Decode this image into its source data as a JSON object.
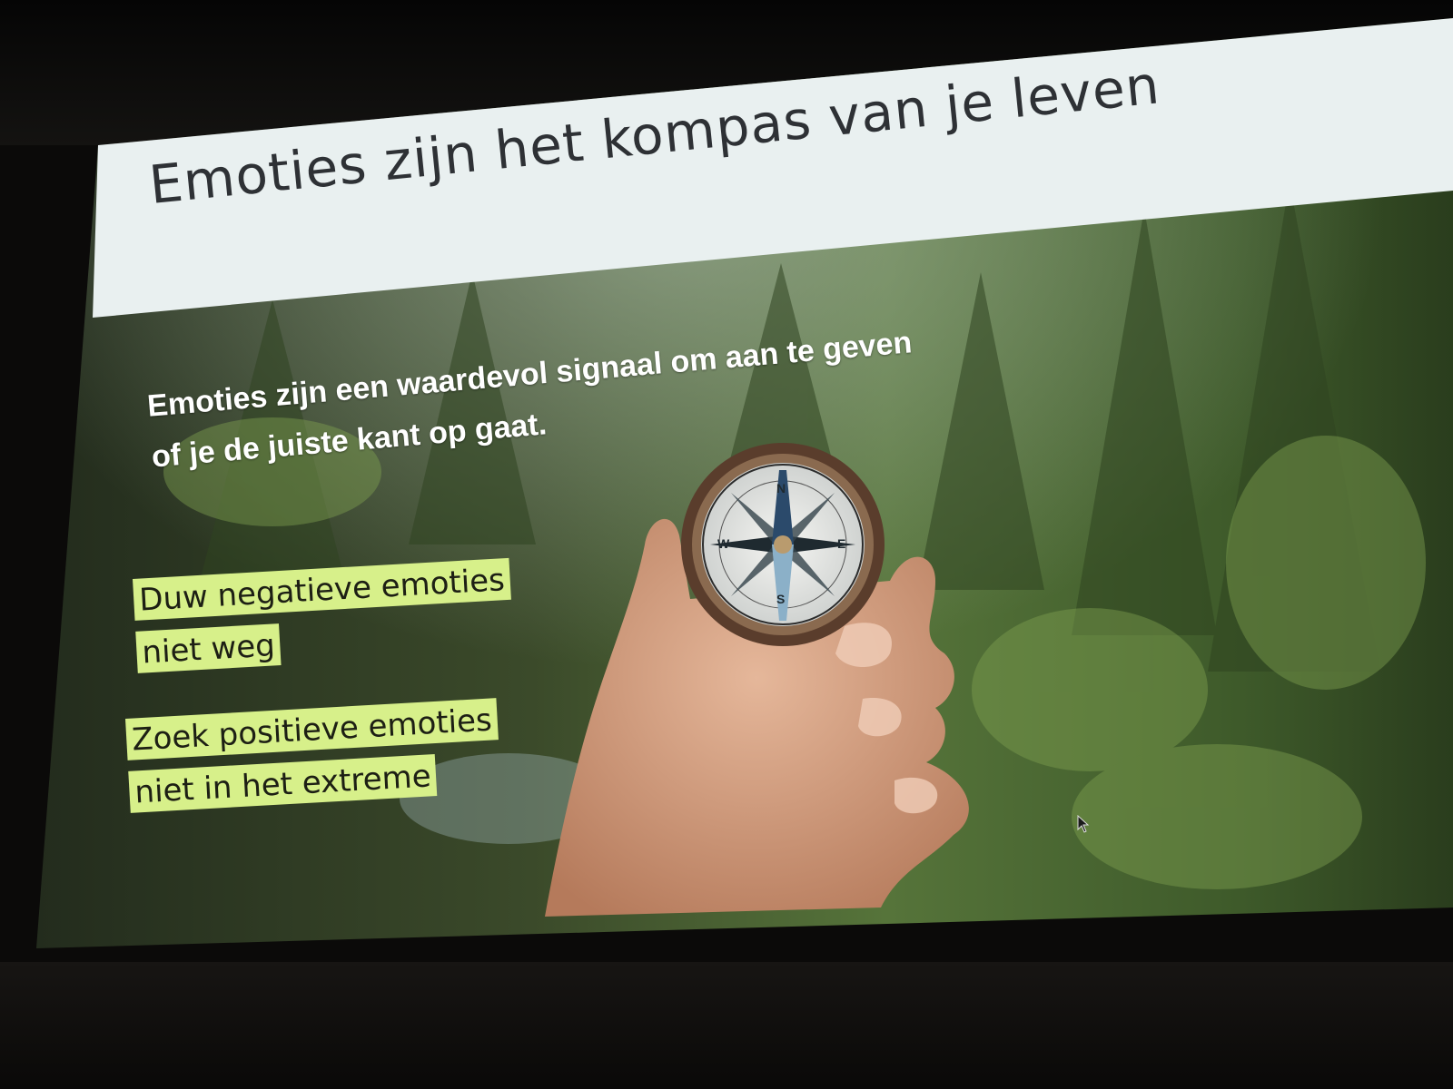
{
  "slide": {
    "title": "Emoties zijn het kompas van je leven",
    "signal_lines": [
      "Emoties zijn een waardevol signaal om aan te geven",
      "of je de juiste kant op gaat."
    ],
    "highlight_1": [
      "Duw negatieve emoties",
      "niet weg"
    ],
    "highlight_2": [
      "Zoek positieve emoties",
      "niet in het extreme"
    ],
    "compass_letters": {
      "n": "N",
      "s": "S",
      "w": "W",
      "e": "E"
    }
  },
  "colors": {
    "title_band": "#e9f0f0",
    "title_text": "#2e3135",
    "highlight": "#d7f08a",
    "forest_dark": "#1e2a17",
    "forest_light": "#6f8f45"
  }
}
